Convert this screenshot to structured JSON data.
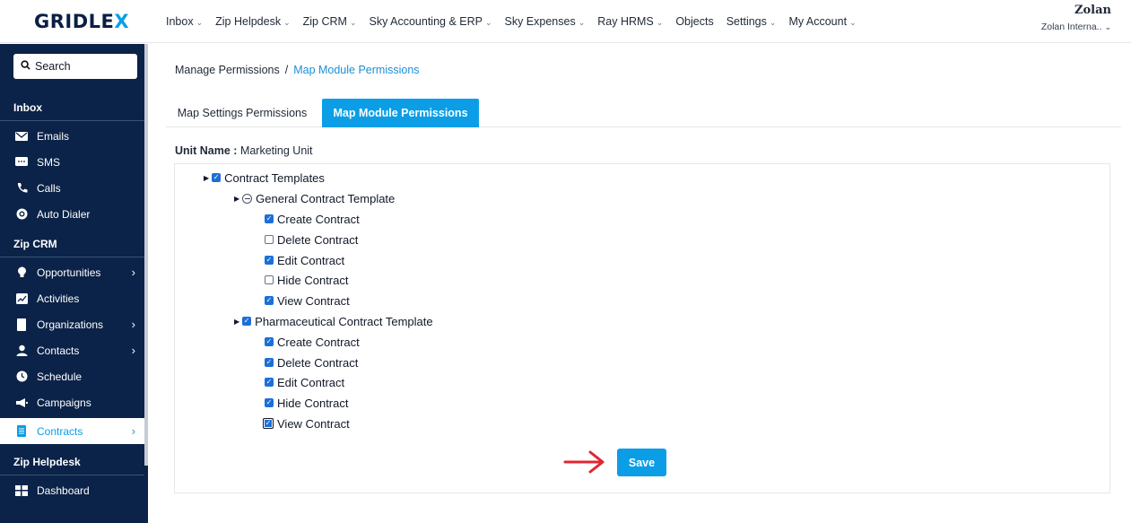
{
  "brand": {
    "logo_main": "GRIDLE",
    "logo_accent": "X"
  },
  "topnav": [
    {
      "label": "Inbox",
      "dropdown": true
    },
    {
      "label": "Zip Helpdesk",
      "dropdown": true
    },
    {
      "label": "Zip CRM",
      "dropdown": true
    },
    {
      "label": "Sky Accounting & ERP",
      "dropdown": true
    },
    {
      "label": "Sky Expenses",
      "dropdown": true
    },
    {
      "label": "Ray HRMS",
      "dropdown": true
    },
    {
      "label": "Objects",
      "dropdown": false
    },
    {
      "label": "Settings",
      "dropdown": true
    },
    {
      "label": "My Account",
      "dropdown": true
    }
  ],
  "account": {
    "company": "Zolan",
    "org": "Zolan Interna.."
  },
  "sidebar": {
    "search_label": "Search",
    "sections": [
      {
        "title": "Inbox"
      },
      {
        "title": "Zip CRM"
      },
      {
        "title": "Zip Helpdesk"
      }
    ],
    "inbox_items": [
      {
        "label": "Emails",
        "icon": "envelope-icon"
      },
      {
        "label": "SMS",
        "icon": "sms-icon"
      },
      {
        "label": "Calls",
        "icon": "phone-icon"
      },
      {
        "label": "Auto Dialer",
        "icon": "dialer-icon"
      }
    ],
    "crm_items": [
      {
        "label": "Opportunities",
        "icon": "lightbulb-icon",
        "has_arrow": true
      },
      {
        "label": "Activities",
        "icon": "activity-chart-icon",
        "has_arrow": false
      },
      {
        "label": "Organizations",
        "icon": "building-icon",
        "has_arrow": true
      },
      {
        "label": "Contacts",
        "icon": "user-icon",
        "has_arrow": true
      },
      {
        "label": "Schedule",
        "icon": "clock-icon",
        "has_arrow": false
      },
      {
        "label": "Campaigns",
        "icon": "megaphone-icon",
        "has_arrow": false
      },
      {
        "label": "Contracts",
        "icon": "document-icon",
        "has_arrow": true,
        "active": true
      }
    ],
    "helpdesk_items": [
      {
        "label": "Dashboard",
        "icon": "dashboard-icon"
      }
    ]
  },
  "breadcrumb": {
    "parent": "Manage Permissions",
    "separator": "/",
    "current": "Map Module Permissions"
  },
  "tabs": [
    {
      "label": "Map Settings Permissions",
      "active": false
    },
    {
      "label": "Map Module Permissions",
      "active": true
    }
  ],
  "unit": {
    "label": "Unit Name :",
    "value": "Marketing Unit"
  },
  "tree": {
    "root": {
      "label": "Contract Templates",
      "state": "checked"
    },
    "groups": [
      {
        "label": "General Contract Template",
        "state": "partial",
        "items": [
          {
            "label": "Create Contract",
            "state": "checked"
          },
          {
            "label": "Delete Contract",
            "state": "unchecked"
          },
          {
            "label": "Edit Contract",
            "state": "checked"
          },
          {
            "label": "Hide Contract",
            "state": "unchecked"
          },
          {
            "label": "View Contract",
            "state": "checked"
          }
        ]
      },
      {
        "label": "Pharmaceutical Contract Template",
        "state": "checked",
        "items": [
          {
            "label": "Create Contract",
            "state": "checked"
          },
          {
            "label": "Delete Contract",
            "state": "checked"
          },
          {
            "label": "Edit Contract",
            "state": "checked"
          },
          {
            "label": "Hide Contract",
            "state": "checked"
          },
          {
            "label": "View Contract",
            "state": "focused"
          }
        ]
      }
    ]
  },
  "actions": {
    "save_label": "Save"
  },
  "colors": {
    "sidebar_bg": "#0b2348",
    "accent": "#0b9ee6",
    "checkbox": "#1d6fd8",
    "arrow": "#e0262f"
  }
}
